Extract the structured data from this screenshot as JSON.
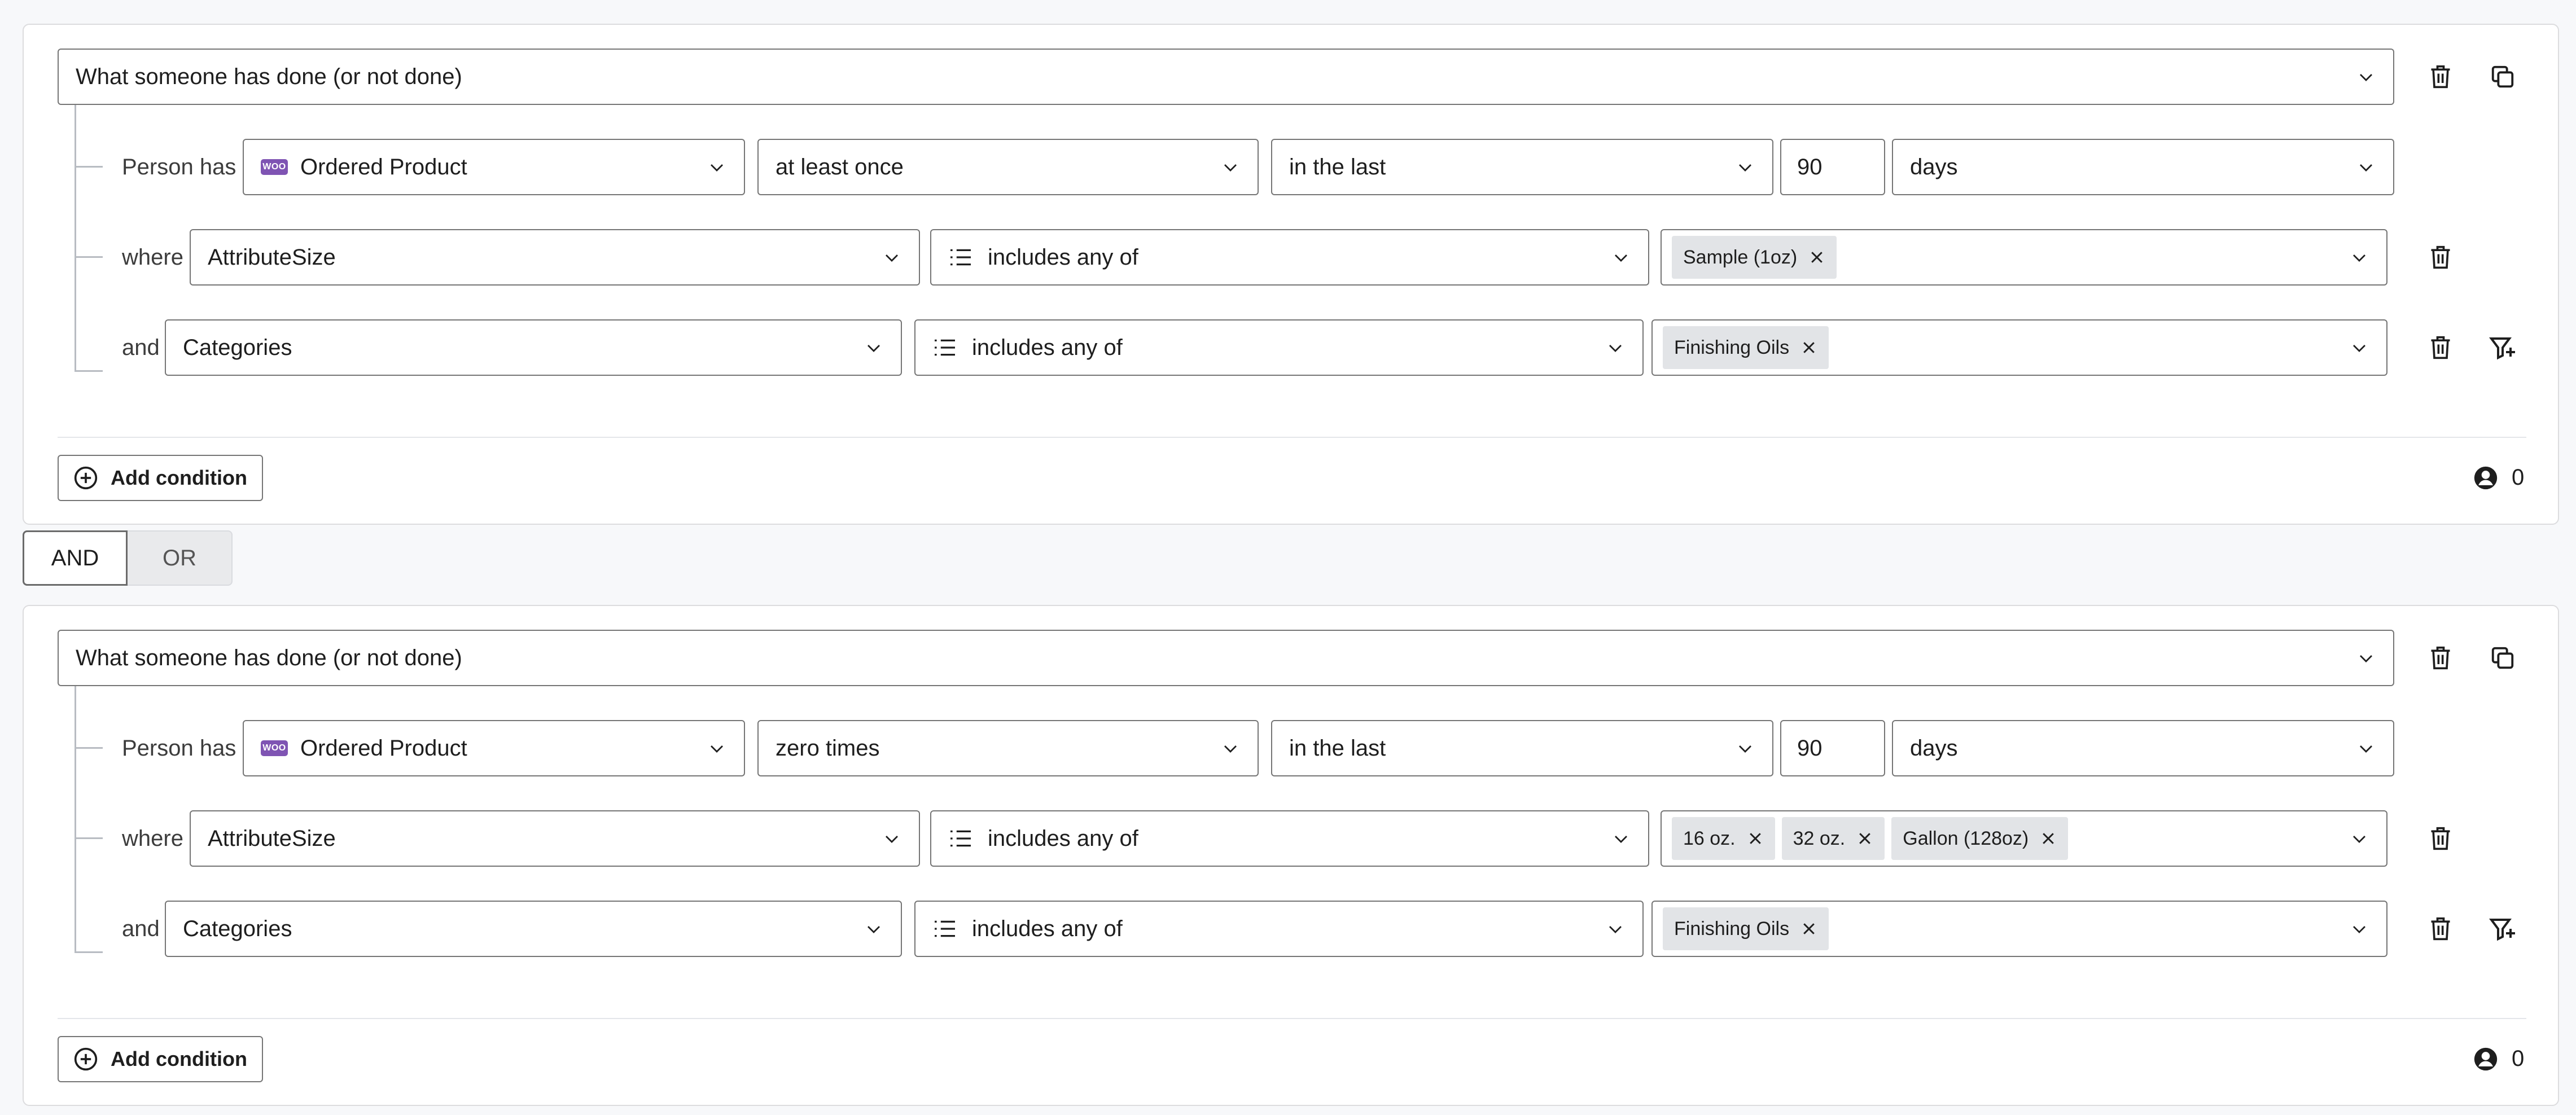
{
  "blocks": [
    {
      "header_select": "What someone has done (or not done)",
      "person_label": "Person has",
      "event_select": "Ordered Product",
      "event_icon": "woo",
      "frequency_select": "at least once",
      "timeframe_select": "in the last",
      "timeframe_value": "90",
      "timeframe_unit": "days",
      "where_label": "where",
      "where_field": "AttributeSize",
      "where_operator": "includes any of",
      "where_tags": [
        "Sample (1oz)"
      ],
      "and_label": "and",
      "and_field": "Categories",
      "and_operator": "includes any of",
      "and_tags": [
        "Finishing Oils"
      ],
      "add_condition_label": "Add condition",
      "count": "0"
    },
    {
      "header_select": "What someone has done (or not done)",
      "person_label": "Person has",
      "event_select": "Ordered Product",
      "event_icon": "woo",
      "frequency_select": "zero times",
      "timeframe_select": "in the last",
      "timeframe_value": "90",
      "timeframe_unit": "days",
      "where_label": "where",
      "where_field": "AttributeSize",
      "where_operator": "includes any of",
      "where_tags": [
        "16 oz.",
        "32 oz.",
        "Gallon (128oz)"
      ],
      "and_label": "and",
      "and_field": "Categories",
      "and_operator": "includes any of",
      "and_tags": [
        "Finishing Oils"
      ],
      "add_condition_label": "Add condition",
      "count": "0"
    }
  ],
  "logic_toggle": {
    "and_label": "AND",
    "or_label": "OR",
    "selected": "AND"
  },
  "icons": {
    "delete": "trash-icon",
    "duplicate": "copy-icon",
    "filter": "filter-plus-icon",
    "add": "plus-circle-icon",
    "person": "person-circle-icon",
    "dropdown": "chevron-down-icon",
    "remove_tag": "close-icon",
    "list": "list-icon"
  },
  "colors": {
    "woo_purple": "#7f54b3",
    "border": "#757575",
    "tag_bg": "#e2e4e7"
  }
}
